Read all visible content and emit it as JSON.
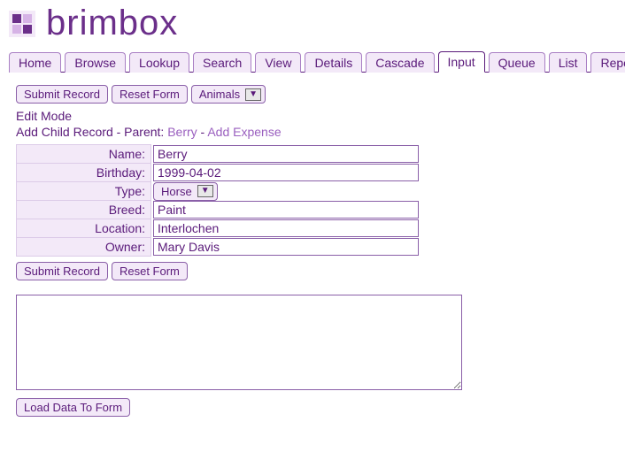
{
  "brand": "brimbox",
  "tabs": [
    "Home",
    "Browse",
    "Lookup",
    "Search",
    "View",
    "Details",
    "Cascade",
    "Input",
    "Queue",
    "List",
    "Reports"
  ],
  "active_tab": "Input",
  "buttons": {
    "submit": "Submit Record",
    "reset": "Reset Form",
    "load": "Load Data To Form"
  },
  "record_type_dropdown": "Animals",
  "mode": "Edit Mode",
  "parent_line": {
    "prefix": "Add Child Record - Parent: ",
    "parent_link": "Berry",
    "separator": " - ",
    "action_link": "Add Expense"
  },
  "form": {
    "name": {
      "label": "Name:",
      "value": "Berry"
    },
    "birthday": {
      "label": "Birthday:",
      "value": "1999-04-02"
    },
    "type": {
      "label": "Type:",
      "value": "Horse"
    },
    "breed": {
      "label": "Breed:",
      "value": "Paint"
    },
    "location": {
      "label": "Location:",
      "value": "Interlochen"
    },
    "owner": {
      "label": "Owner:",
      "value": "Mary Davis"
    }
  },
  "textarea": ""
}
